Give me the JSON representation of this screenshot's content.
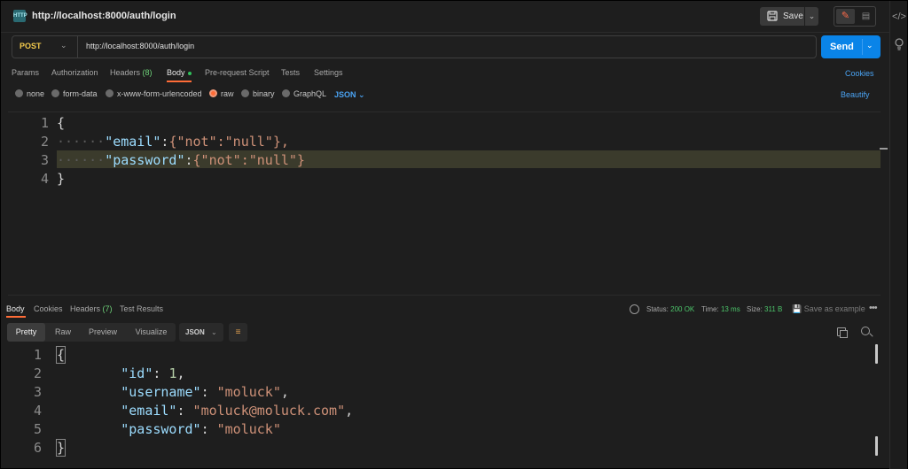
{
  "topbar": {
    "request_icon": "http-request-icon",
    "title": "http://localhost:8000/auth/login",
    "save_label": "Save"
  },
  "request": {
    "method": "POST",
    "url": "http://localhost:8000/auth/login",
    "send_label": "Send"
  },
  "request_tabs": {
    "items": [
      {
        "label": "Params"
      },
      {
        "label": "Authorization"
      },
      {
        "label": "Headers",
        "count": "(8)"
      },
      {
        "label": "Body"
      },
      {
        "label": "Pre-request Script"
      },
      {
        "label": "Tests"
      },
      {
        "label": "Settings"
      }
    ],
    "active": "Body",
    "cookies_label": "Cookies"
  },
  "body_types": {
    "items": [
      "none",
      "form-data",
      "x-www-form-urlencoded",
      "raw",
      "binary",
      "GraphQL"
    ],
    "selected": "raw",
    "language": "JSON",
    "beautify_label": "Beautify"
  },
  "request_body": {
    "line_numbers": [
      "1",
      "2",
      "3",
      "4"
    ],
    "lines": [
      {
        "open": "{"
      },
      {
        "key": "\"email\"",
        "value": "{\"not\":\"null\"},"
      },
      {
        "key": "\"password\"",
        "value": "{\"not\":\"null\"}"
      },
      {
        "close": "}"
      }
    ]
  },
  "response": {
    "tabs": [
      {
        "label": "Body"
      },
      {
        "label": "Cookies"
      },
      {
        "label": "Headers",
        "count": "(7)"
      },
      {
        "label": "Test Results"
      }
    ],
    "status_label": "Status:",
    "status_value": "200 OK",
    "time_label": "Time:",
    "time_value": "13 ms",
    "size_label": "Size:",
    "size_value": "311 B",
    "save_example_label": "Save as example",
    "view_tabs": [
      "Pretty",
      "Raw",
      "Preview",
      "Visualize"
    ],
    "active_view": "Pretty",
    "format": "JSON",
    "line_numbers": [
      "1",
      "2",
      "3",
      "4",
      "5",
      "6"
    ],
    "body": {
      "id": "1",
      "username": "moluck",
      "email": "moluck@moluck.com",
      "password": "moluck"
    }
  },
  "icons": [
    "code-icon",
    "lightbulb-icon",
    "save-icon",
    "pencil-icon",
    "document-icon",
    "globe-icon",
    "copy-icon",
    "search-icon",
    "wrap-icon",
    "more-icon"
  ]
}
